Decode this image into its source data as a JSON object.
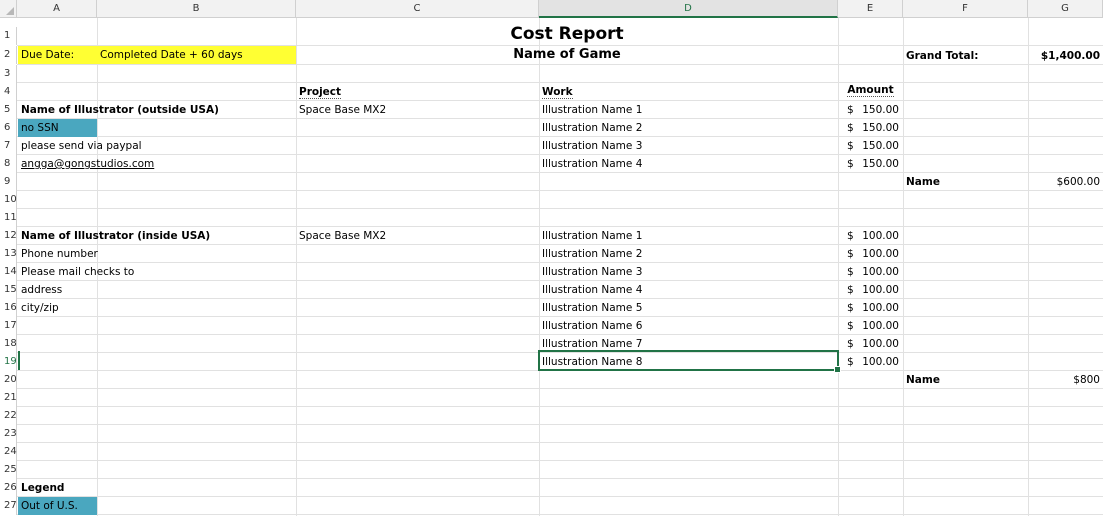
{
  "columns": [
    "A",
    "B",
    "C",
    "D",
    "E",
    "F",
    "G"
  ],
  "active_column": "D",
  "rows": [
    "1",
    "2",
    "3",
    "4",
    "5",
    "6",
    "7",
    "8",
    "9",
    "10",
    "11",
    "12",
    "13",
    "14",
    "15",
    "16",
    "17",
    "18",
    "19",
    "20",
    "21",
    "22",
    "23",
    "24",
    "25",
    "26",
    "27"
  ],
  "active_row": "19",
  "header": {
    "title": "Cost Report",
    "subtitle": "Name of Game",
    "due_date_label": "Due Date:",
    "due_date_value": "Completed Date + 60 days",
    "grand_total_label": "Grand Total:",
    "grand_total_value": "$1,400.00"
  },
  "table_headers": {
    "project": "Project",
    "work": "Work",
    "amount": "Amount"
  },
  "outside_usa": {
    "label": "Name of Illustrator (outside USA)",
    "ssn": "no SSN",
    "payment": "please send via paypal",
    "email": "angga@gongstudios.com",
    "project": "Space Base MX2",
    "items": [
      {
        "work": "Illustration Name 1",
        "currency": "$",
        "amount": "150.00"
      },
      {
        "work": "Illustration Name 2",
        "currency": "$",
        "amount": "150.00"
      },
      {
        "work": "Illustration Name 3",
        "currency": "$",
        "amount": "150.00"
      },
      {
        "work": "Illustration Name 4",
        "currency": "$",
        "amount": "150.00"
      }
    ],
    "subtotal_label": "Name",
    "subtotal_value": "$600.00"
  },
  "inside_usa": {
    "label": "Name of Illustrator (inside USA)",
    "phone": "Phone number",
    "mail": "Please mail checks to",
    "address": "address",
    "cityzip": "city/zip",
    "project": "Space Base MX2",
    "items": [
      {
        "work": "Illustration Name 1",
        "currency": "$",
        "amount": "100.00"
      },
      {
        "work": "Illustration Name 2",
        "currency": "$",
        "amount": "100.00"
      },
      {
        "work": "Illustration Name 3",
        "currency": "$",
        "amount": "100.00"
      },
      {
        "work": "Illustration Name 4",
        "currency": "$",
        "amount": "100.00"
      },
      {
        "work": "Illustration Name 5",
        "currency": "$",
        "amount": "100.00"
      },
      {
        "work": "Illustration Name 6",
        "currency": "$",
        "amount": "100.00"
      },
      {
        "work": "Illustration Name 7",
        "currency": "$",
        "amount": "100.00"
      },
      {
        "work": "Illustration Name 8",
        "currency": "$",
        "amount": "100.00"
      }
    ],
    "subtotal_label": "Name",
    "subtotal_value": "$800"
  },
  "legend": {
    "label": "Legend",
    "out_of_us": "Out of U.S."
  },
  "colors": {
    "yellow_fill": "#ffff33",
    "teal_fill": "#4aa7bf",
    "selection": "#217346"
  }
}
